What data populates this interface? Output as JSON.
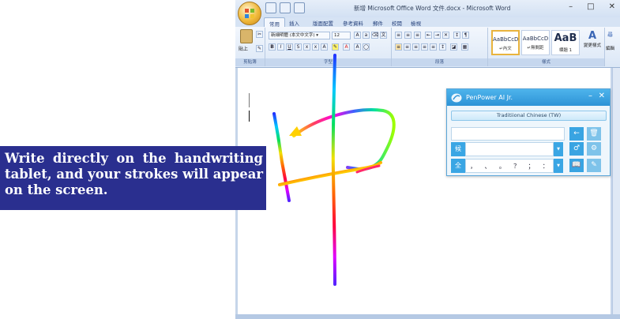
{
  "window": {
    "title": "新增 Microsoft Office Word 文件.docx - Microsoft Word",
    "minimize": "–",
    "maximize": "□",
    "close": "✕"
  },
  "ribbon": {
    "tabs": [
      "常用",
      "插入",
      "版面配置",
      "參考資料",
      "郵件",
      "校閱",
      "檢視"
    ],
    "paste_label": "貼上",
    "font_name": "新細明體 (本文中文字) ▾",
    "font_size": "12",
    "groups": {
      "clipboard": "剪貼簿",
      "font": "字型",
      "paragraph": "段落",
      "styles": "樣式",
      "edit": "編輯"
    },
    "styles": [
      {
        "sample": "AaBbCcD",
        "name": "↵內文"
      },
      {
        "sample": "AaBbCcD",
        "name": "↵無間距"
      },
      {
        "sample": "AaB",
        "name": "標題 1"
      }
    ],
    "change_styles": "變更樣式"
  },
  "penpower": {
    "title": "PenPower AI Jr.",
    "minimize": "–",
    "close": "✕",
    "language": "Traditiional Chinese (TW)",
    "candidate_label": "候",
    "full_label": "全",
    "punctuation": [
      "，",
      "、",
      "。",
      "？",
      "；",
      "："
    ]
  },
  "caption": "Write directly on the handwriting tablet, and your strokes will appear on the screen."
}
